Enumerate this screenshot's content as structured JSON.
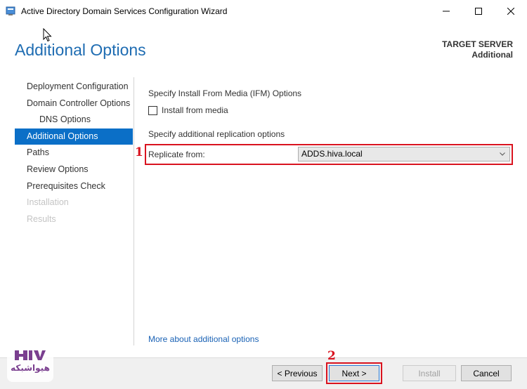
{
  "window": {
    "title": "Active Directory Domain Services Configuration Wizard"
  },
  "header": {
    "page_title": "Additional Options",
    "target_server_label": "TARGET SERVER",
    "target_server_value": "Additional"
  },
  "nav": {
    "items": [
      {
        "label": "Deployment Configuration",
        "state": "normal"
      },
      {
        "label": "Domain Controller Options",
        "state": "normal"
      },
      {
        "label": "DNS Options",
        "state": "sub"
      },
      {
        "label": "Additional Options",
        "state": "active"
      },
      {
        "label": "Paths",
        "state": "normal"
      },
      {
        "label": "Review Options",
        "state": "normal"
      },
      {
        "label": "Prerequisites Check",
        "state": "normal"
      },
      {
        "label": "Installation",
        "state": "disabled"
      },
      {
        "label": "Results",
        "state": "disabled"
      }
    ]
  },
  "main": {
    "ifm_heading": "Specify Install From Media (IFM) Options",
    "install_from_media_label": "Install from media",
    "install_from_media_checked": false,
    "replication_heading": "Specify additional replication options",
    "replicate_from_label": "Replicate from:",
    "replicate_from_value": "ADDS.hiva.local",
    "more_link": "More about additional options"
  },
  "annotations": {
    "marker_1": "1",
    "marker_2": "2",
    "color": "#d9131f"
  },
  "buttons": {
    "previous": "< Previous",
    "next": "Next >",
    "install": "Install",
    "cancel": "Cancel"
  },
  "watermark": {
    "text": "هیواشبکه"
  },
  "colors": {
    "accent": "#0b6fc7",
    "heading": "#1e6cb2",
    "link": "#1a62b5"
  },
  "icons": {
    "app": "wizard-app-icon",
    "minimize": "minimize-icon",
    "maximize": "maximize-icon",
    "close": "close-icon",
    "cursor": "mouse-cursor-icon",
    "dropdown": "chevron-down-icon",
    "logo": "hiva-logo-icon"
  }
}
